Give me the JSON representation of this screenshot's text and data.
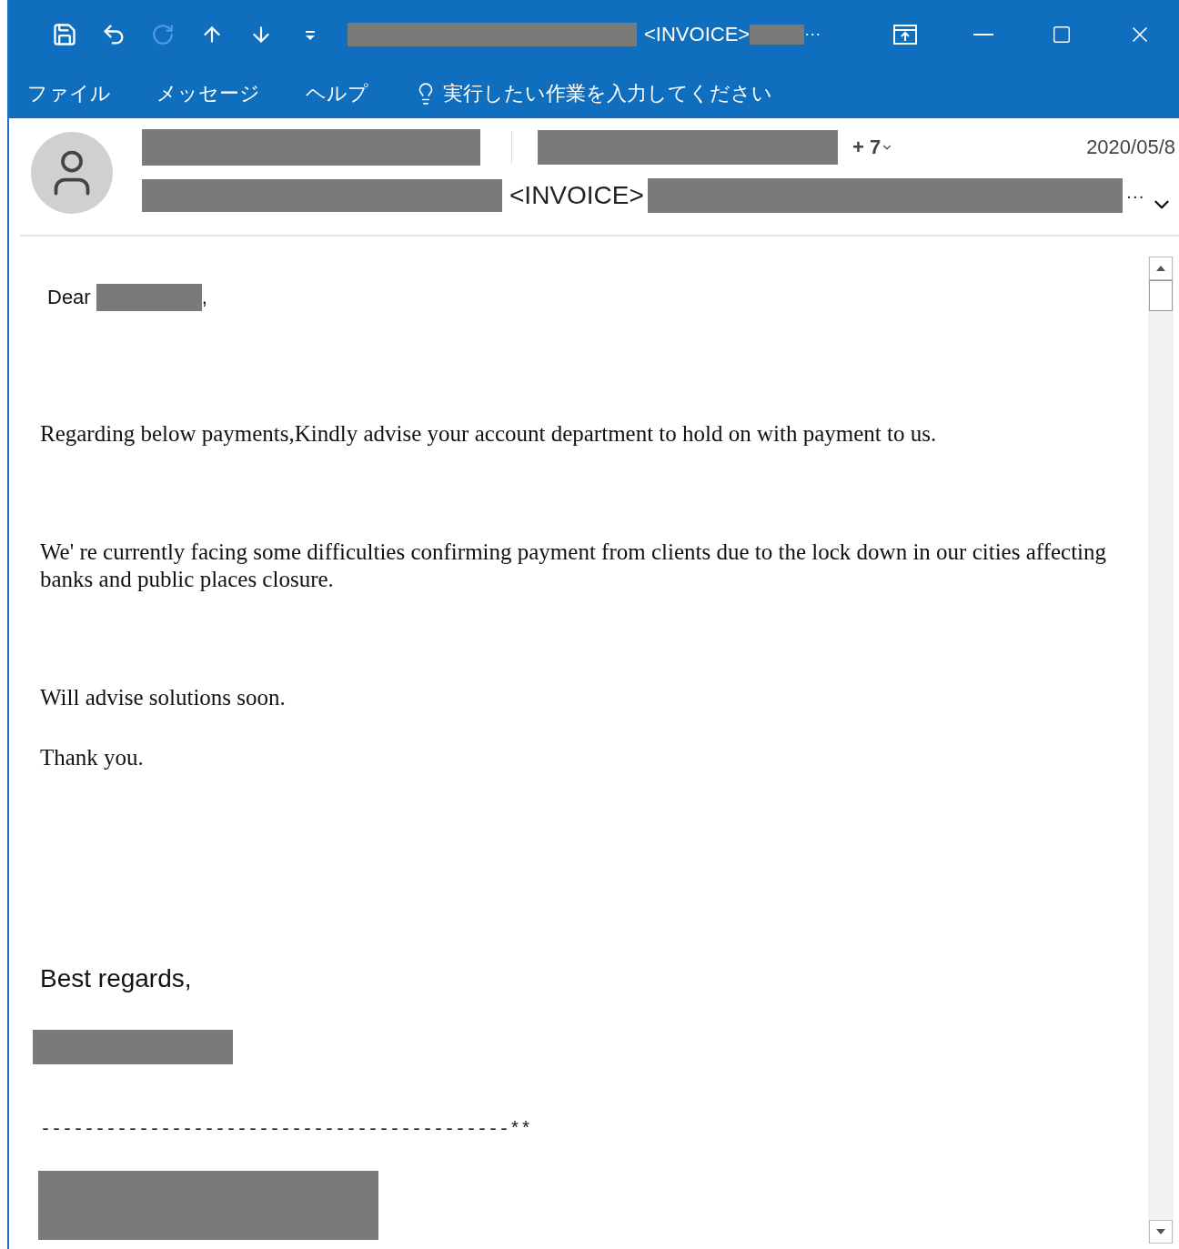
{
  "title_bar": {
    "quick_access": [
      {
        "kind": "save",
        "disabled": false
      },
      {
        "kind": "undo",
        "disabled": false
      },
      {
        "kind": "redo",
        "disabled": true
      },
      {
        "kind": "up",
        "disabled": false
      },
      {
        "kind": "down",
        "disabled": false
      },
      {
        "kind": "customize",
        "disabled": false
      }
    ],
    "title": "<INVOICE>",
    "title_ellipsis": "···"
  },
  "menu": {
    "items": [
      "ファイル",
      "メッセージ",
      "ヘルプ"
    ],
    "tell_me": "実行したい作業を入力してください"
  },
  "header": {
    "recipients_more": "+ 7",
    "date": "2020/05/8",
    "subject": "<INVOICE>",
    "subject_ellipsis": "···"
  },
  "body": {
    "greeting": "Dear",
    "greeting_comma": ",",
    "paragraphs": [
      "Regarding below payments,Kindly advise your account department to hold on with payment to us.",
      "We' re currently facing some difficulties confirming payment from clients due to the lock down in our cities affecting banks and public places closure.",
      "Will advise solutions soon.",
      "Thank you."
    ],
    "closing": "Best regards,",
    "separator": "-------------------------------------------**"
  }
}
